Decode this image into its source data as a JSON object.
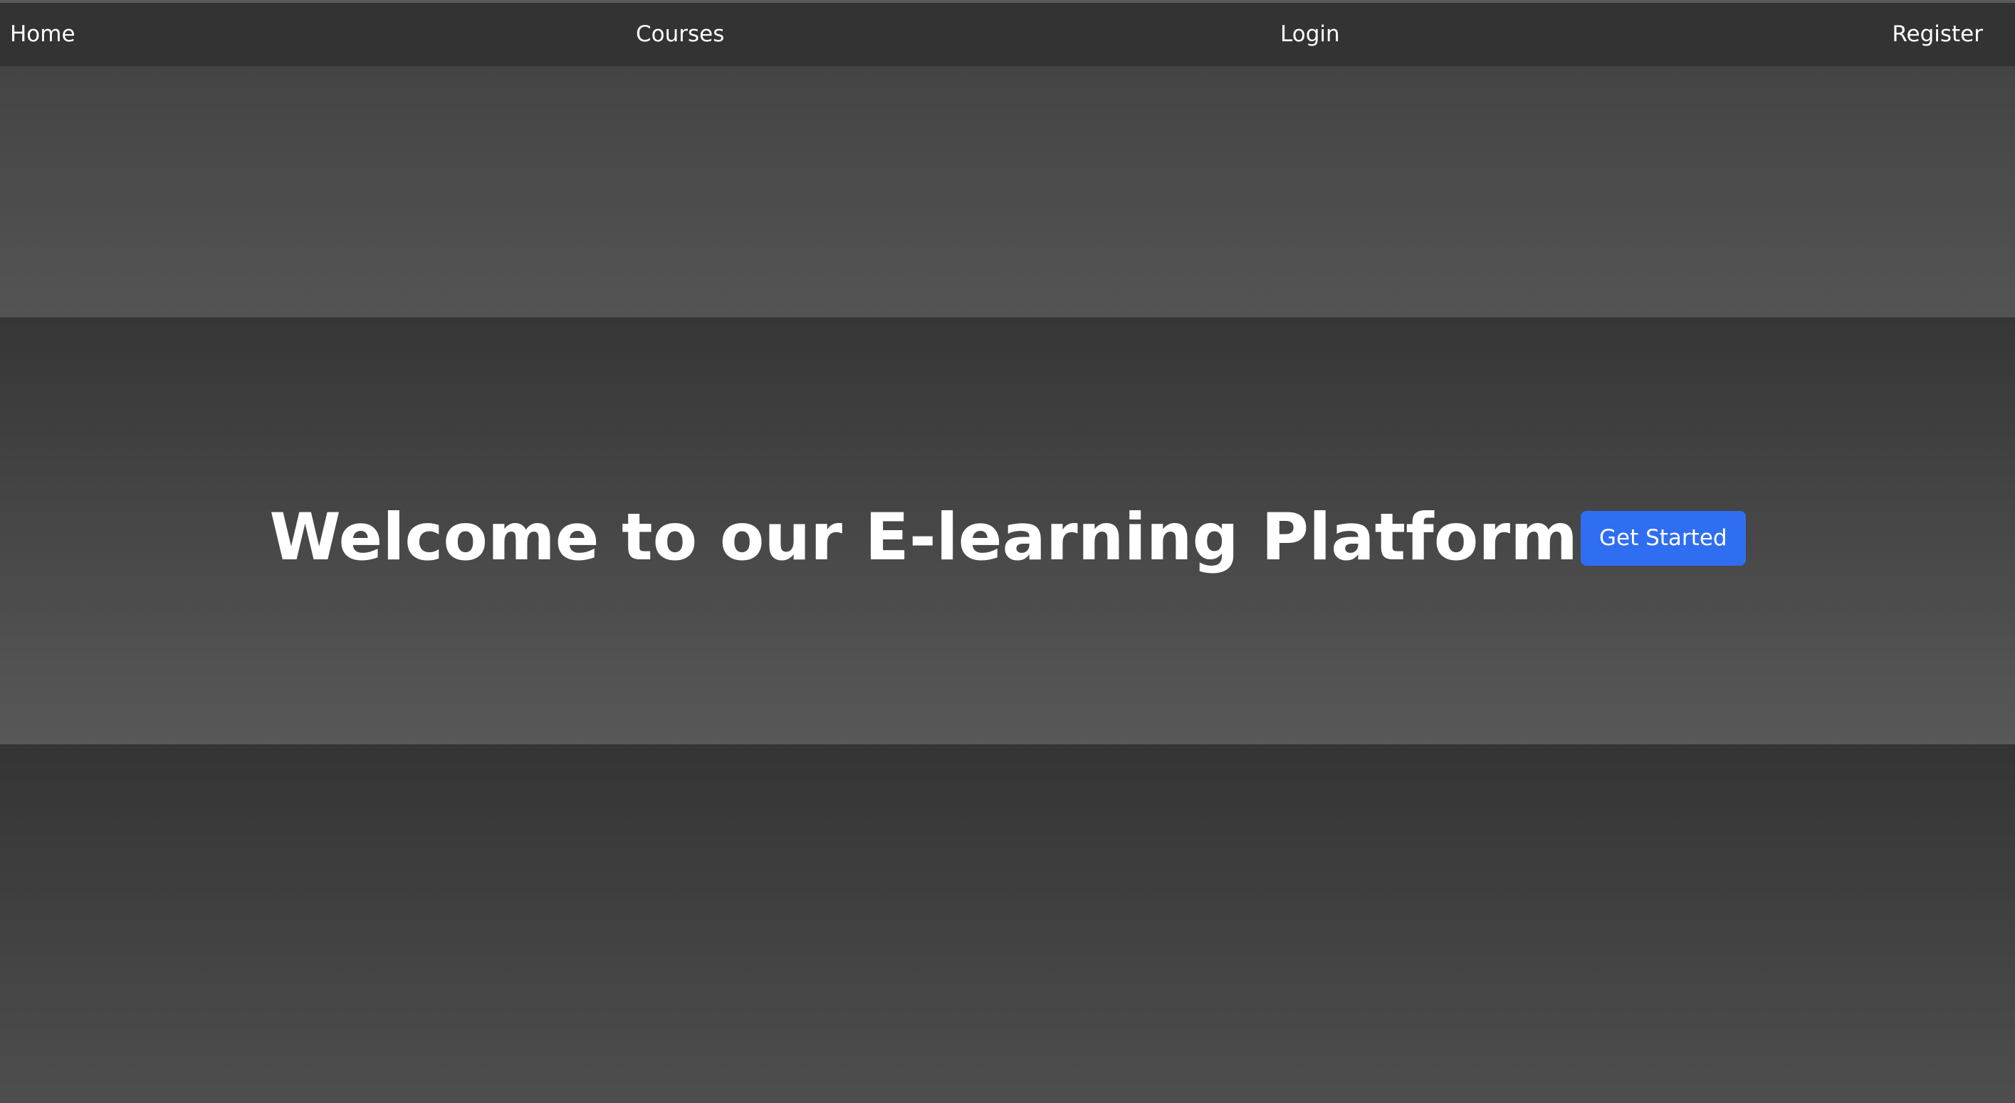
{
  "nav": {
    "home": "Home",
    "courses": "Courses",
    "login": "Login",
    "register": "Register"
  },
  "hero": {
    "title": "Welcome to our E-learning Platform",
    "cta_label": "Get Started"
  },
  "colors": {
    "navbar_bg": "#333333",
    "accent": "#2f6ef0",
    "text": "#ffffff"
  }
}
